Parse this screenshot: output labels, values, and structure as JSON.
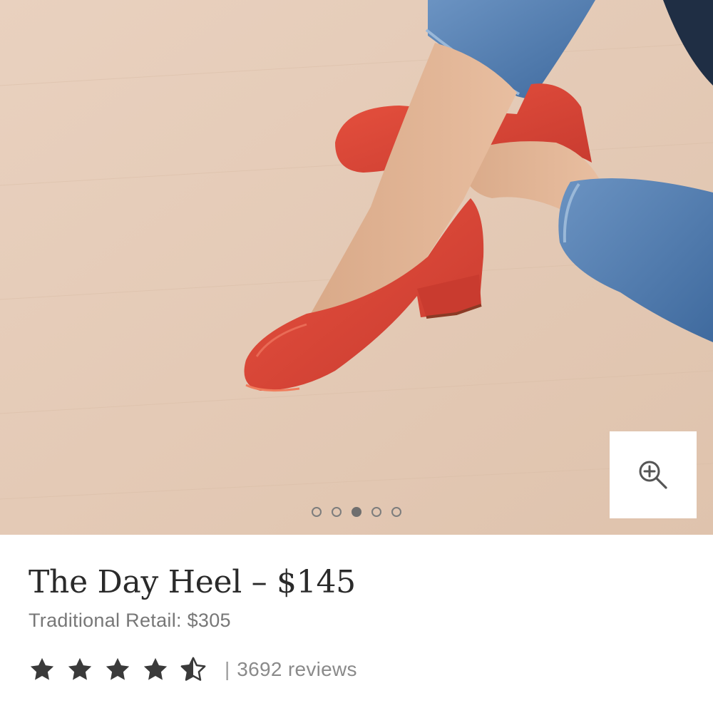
{
  "product": {
    "title": "The Day Heel – $145",
    "traditional_retail": "Traditional Retail: $305"
  },
  "rating": {
    "value": 4.5,
    "max": 5,
    "divider": "|",
    "reviews_text": "3692 reviews"
  },
  "carousel": {
    "slide_count": 5,
    "active_index": 2
  },
  "hero_image": {
    "alt": "Red leather block-heel pumps worn with cuffed blue jeans on a light wood floor"
  },
  "icons": {
    "zoom": "zoom-in-icon",
    "star_full": "star-filled-icon",
    "star_half": "star-half-icon"
  },
  "colors": {
    "shoe_red": "#e0463a",
    "floor": "#e6ccb7",
    "denim": "#5c86b8",
    "star": "#3a3a3a",
    "title_text": "#2a2a2a",
    "muted_text": "#777777"
  }
}
